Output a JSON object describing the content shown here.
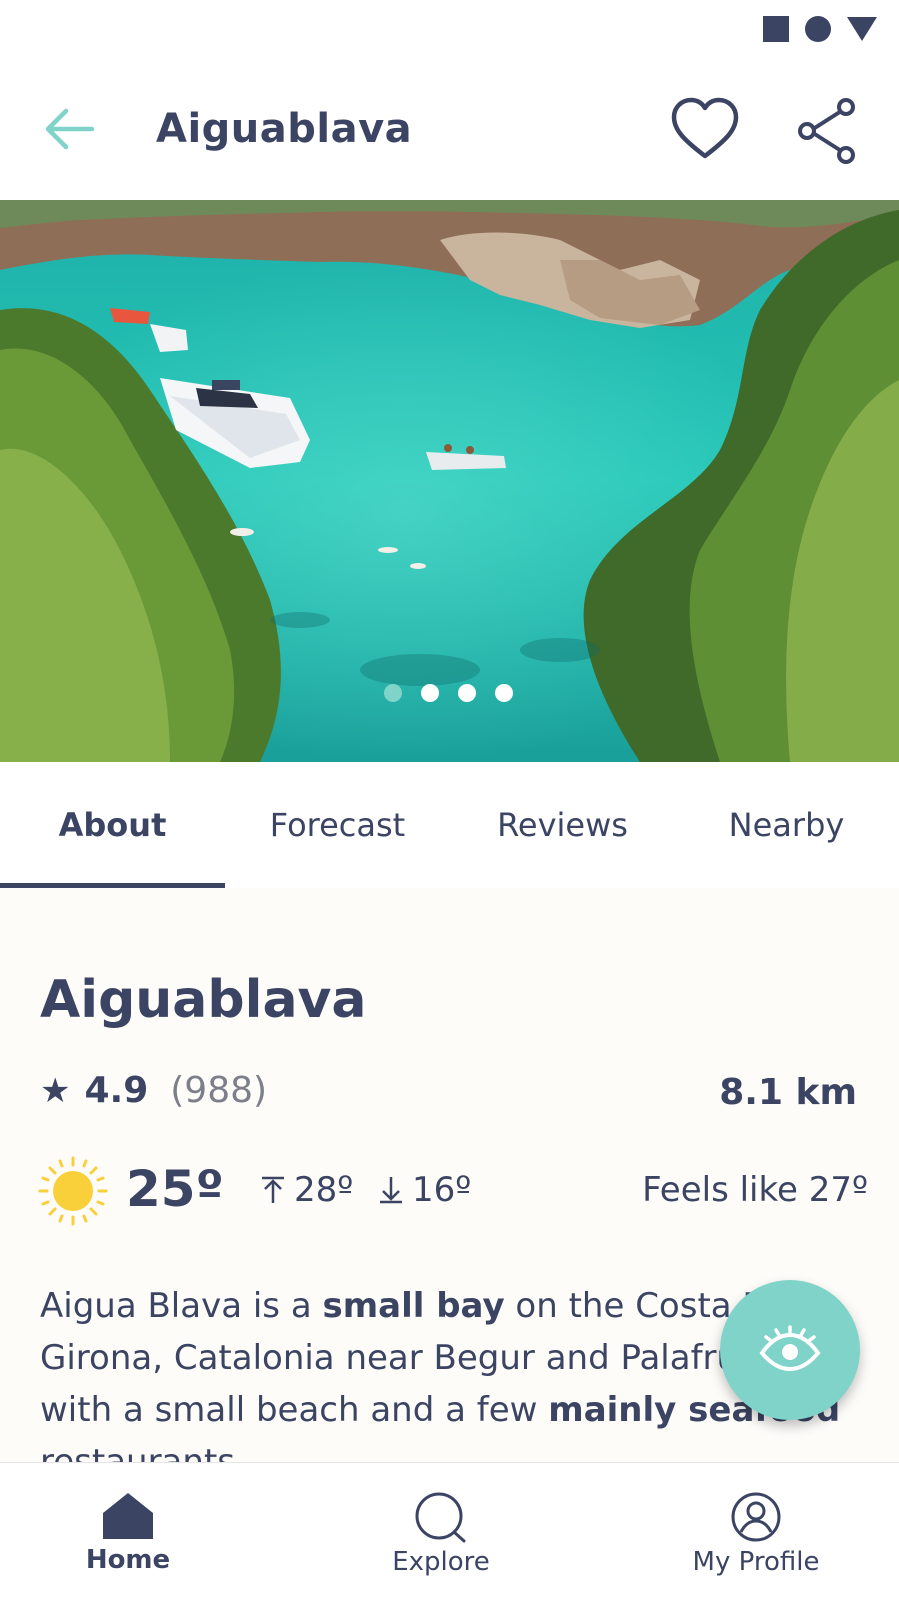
{
  "status_bar": {
    "icons": [
      "square-icon",
      "circle-icon",
      "triangle-icon"
    ]
  },
  "app_bar": {
    "title": "Aiguablava",
    "back_icon": "arrow-left-icon",
    "favorite_icon": "heart-icon",
    "share_icon": "share-icon"
  },
  "gallery": {
    "total_images": 4,
    "active_index": 0
  },
  "tabs": [
    {
      "label": "About",
      "active": true
    },
    {
      "label": "Forecast",
      "active": false
    },
    {
      "label": "Reviews",
      "active": false
    },
    {
      "label": "Nearby",
      "active": false
    }
  ],
  "place": {
    "title": "Aiguablava",
    "rating": "4.9",
    "review_count": "(988)",
    "distance": "8.1 km"
  },
  "weather": {
    "icon": "sun-icon",
    "temp": "25º",
    "high": "28º",
    "low": "16º",
    "feels_like": "Feels like 27º"
  },
  "description": {
    "p1": "Aigua Blava is a ",
    "b1": "small bay",
    "p2": " on the Costa Brava, Girona, Catalonia near Begur and Palafrugell, with a small beach and a few ",
    "b2": "mainly seafood",
    "p3": " restaurants."
  },
  "fab": {
    "icon": "eye-icon"
  },
  "bottom_nav": [
    {
      "label": "Home",
      "icon": "home-icon",
      "active": true
    },
    {
      "label": "Explore",
      "icon": "search-icon",
      "active": false
    },
    {
      "label": "My Profile",
      "icon": "profile-icon",
      "active": false
    }
  ],
  "colors": {
    "primary": "#3b4463",
    "accent": "#7fd3c9",
    "sun": "#f9cf3a",
    "background": "#fdfcf9"
  }
}
